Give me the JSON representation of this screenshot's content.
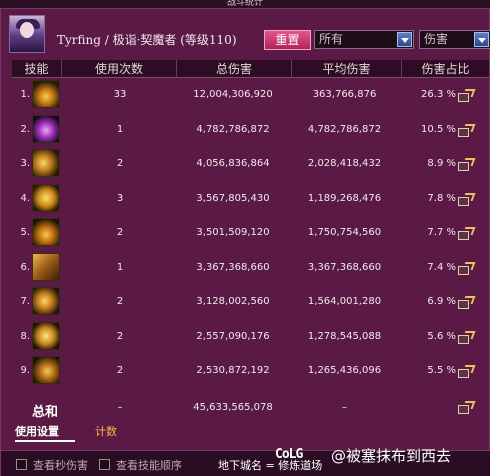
{
  "window": {
    "title": "战斗统计"
  },
  "character": {
    "name": "Tyrfing / 极诣·契魔者 (等级110)"
  },
  "controls": {
    "reset_label": "重置",
    "filter_select": "所有",
    "type_select": "伤害"
  },
  "table": {
    "headers": [
      "技能",
      "使用次数",
      "总伤害",
      "平均伤害",
      "伤害占比"
    ],
    "rows": [
      {
        "index": "1.",
        "uses": "33",
        "total": "12,004,306,920",
        "avg": "363,766,876",
        "pct": "26.3 %",
        "icon": "skill-1-icon"
      },
      {
        "index": "2.",
        "uses": "1",
        "total": "4,782,786,872",
        "avg": "4,782,786,872",
        "pct": "10.5 %",
        "icon": "skill-2-icon"
      },
      {
        "index": "3.",
        "uses": "2",
        "total": "4,056,836,864",
        "avg": "2,028,418,432",
        "pct": "8.9 %",
        "icon": "skill-3-icon"
      },
      {
        "index": "4.",
        "uses": "3",
        "total": "3,567,805,430",
        "avg": "1,189,268,476",
        "pct": "7.8 %",
        "icon": "skill-4-icon"
      },
      {
        "index": "5.",
        "uses": "2",
        "total": "3,501,509,120",
        "avg": "1,750,754,560",
        "pct": "7.7 %",
        "icon": "skill-5-icon"
      },
      {
        "index": "6.",
        "uses": "1",
        "total": "3,367,368,660",
        "avg": "3,367,368,660",
        "pct": "7.4 %",
        "icon": "skill-6-icon"
      },
      {
        "index": "7.",
        "uses": "2",
        "total": "3,128,002,560",
        "avg": "1,564,001,280",
        "pct": "6.9 %",
        "icon": "skill-7-icon"
      },
      {
        "index": "8.",
        "uses": "2",
        "total": "2,557,090,176",
        "avg": "1,278,545,088",
        "pct": "5.6 %",
        "icon": "skill-8-icon"
      },
      {
        "index": "9.",
        "uses": "2",
        "total": "2,530,872,192",
        "avg": "1,265,436,096",
        "pct": "5.5 %",
        "icon": "skill-9-icon"
      }
    ],
    "summary": {
      "label": "总和",
      "uses": "–",
      "total": "45,633,565,078",
      "avg": "–"
    }
  },
  "tabs": {
    "settings": "使用设置",
    "count": "计数"
  },
  "footer": {
    "check_dps": "查看秒伤害",
    "check_order": "查看技能顺序",
    "dungeon": "地下城名 = 修炼道场"
  },
  "watermark": {
    "logo": "CoLG",
    "text": "@被塞抹布到西去"
  },
  "colors": {
    "background": "#5a1a45",
    "header": "#2e0d24",
    "button": "#d63f78",
    "tab_active": "#ffffff",
    "tab_inactive": "#ffb347"
  }
}
